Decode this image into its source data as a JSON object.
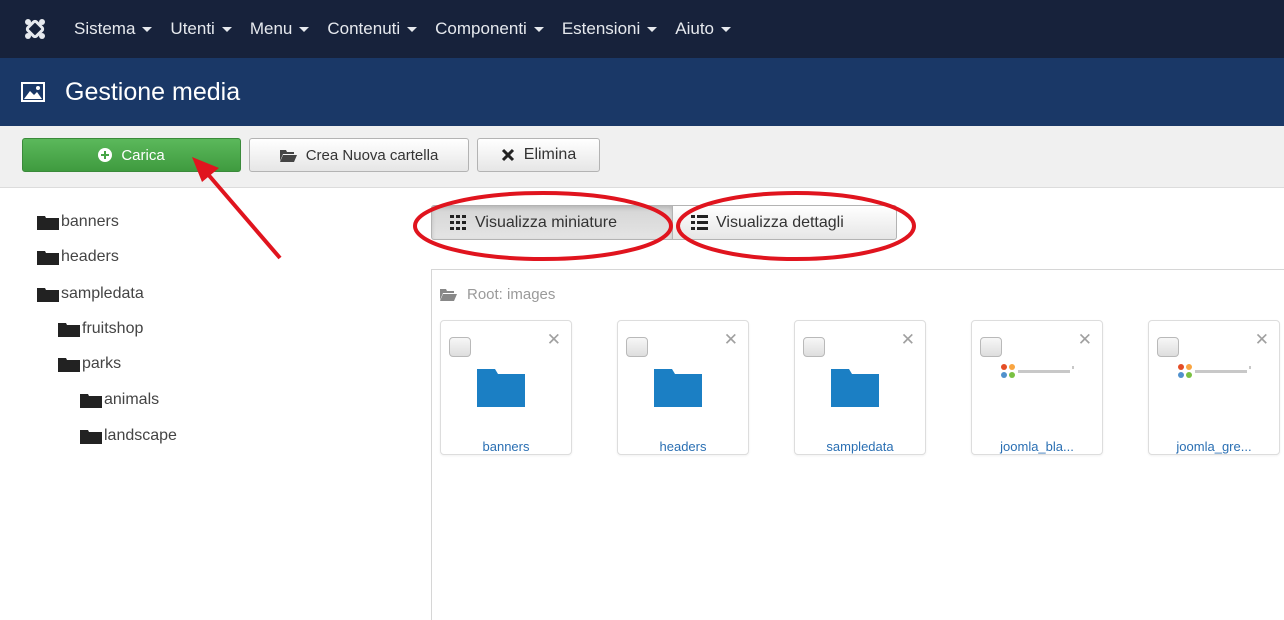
{
  "navbar": {
    "items": [
      {
        "label": "Sistema"
      },
      {
        "label": "Utenti"
      },
      {
        "label": "Menu"
      },
      {
        "label": "Contenuti"
      },
      {
        "label": "Componenti"
      },
      {
        "label": "Estensioni"
      },
      {
        "label": "Aiuto"
      }
    ]
  },
  "titlebar": {
    "title": "Gestione media"
  },
  "toolbar": {
    "upload_label": "Carica",
    "new_folder_label": "Crea Nuova cartella",
    "delete_label": "Elimina"
  },
  "tree": {
    "items": [
      {
        "label": "banners",
        "depth": 0
      },
      {
        "label": "headers",
        "depth": 0
      },
      {
        "label": "sampledata",
        "depth": 0
      },
      {
        "label": "fruitshop",
        "depth": 1
      },
      {
        "label": "parks",
        "depth": 1
      },
      {
        "label": "animals",
        "depth": 2
      },
      {
        "label": "landscape",
        "depth": 2
      }
    ]
  },
  "views": {
    "thumbnails_label": "Visualizza miniature",
    "details_label": "Visualizza dettagli",
    "active": "thumbnails"
  },
  "media": {
    "root_path": "Root: images",
    "items": [
      {
        "name": "banners",
        "kind": "folder"
      },
      {
        "name": "headers",
        "kind": "folder"
      },
      {
        "name": "sampledata",
        "kind": "folder"
      },
      {
        "name": "joomla_bla...",
        "kind": "image"
      },
      {
        "name": "joomla_gre...",
        "kind": "image"
      }
    ]
  },
  "colors": {
    "navbar_bg": "#17223b",
    "titlebar_bg": "#1a3867",
    "upload_green": "#46a546",
    "folder_blue": "#1b7fc4",
    "link_blue": "#2a6fb3",
    "annotation_red": "#e0141e"
  },
  "icons": {
    "brand": "joomla-logo-icon",
    "title": "image-icon",
    "upload": "plus-circle-icon",
    "new_folder": "folder-open-icon",
    "delete": "x-icon",
    "thumbnails": "grid-icon",
    "details": "list-icon"
  }
}
